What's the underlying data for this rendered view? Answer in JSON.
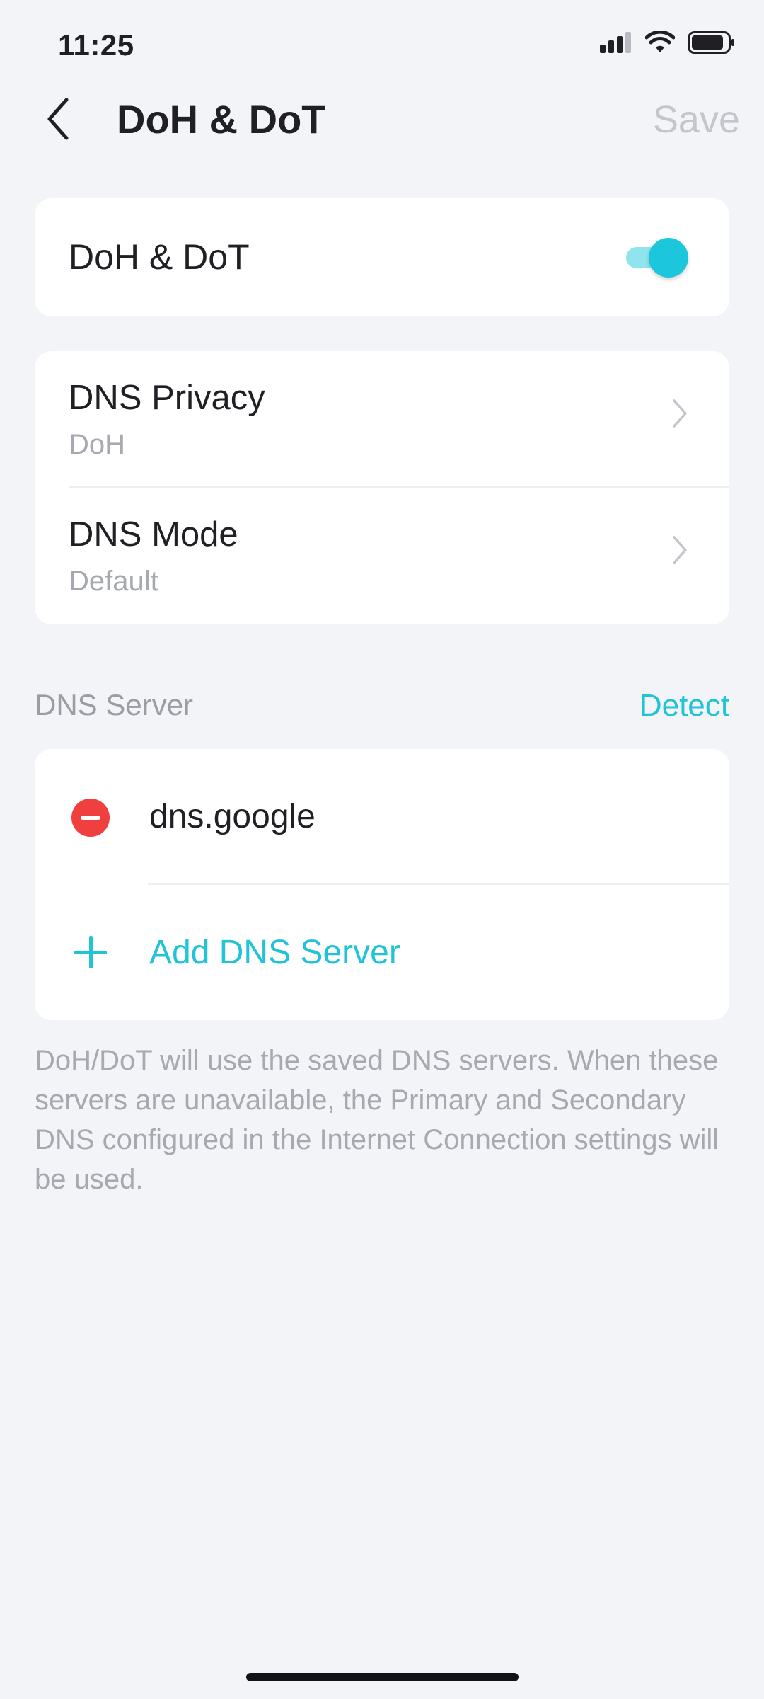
{
  "status_bar": {
    "time": "11:25",
    "icons": [
      "signal-icon",
      "wifi-icon",
      "battery-icon"
    ]
  },
  "header": {
    "title": "DoH & DoT",
    "back_icon": "chevron-left-icon",
    "save_label": "Save"
  },
  "toggle_card": {
    "label": "DoH & DoT",
    "enabled": true
  },
  "settings": {
    "items": [
      {
        "title": "DNS Privacy",
        "value": "DoH"
      },
      {
        "title": "DNS Mode",
        "value": "Default"
      }
    ]
  },
  "dns_server": {
    "section_title": "DNS Server",
    "detect_label": "Detect",
    "servers": [
      {
        "name": "dns.google"
      }
    ],
    "add_label": "Add DNS Server"
  },
  "footnote": "DoH/DoT will use the saved DNS servers. When these servers are unavailable, the Primary and Secondary DNS configured in the Internet Connection settings will be used.",
  "colors": {
    "accent": "#21c3d7",
    "danger": "#ef3f3f",
    "background": "#f3f4f8",
    "card": "#ffffff",
    "muted_text": "#a7a9b0"
  }
}
